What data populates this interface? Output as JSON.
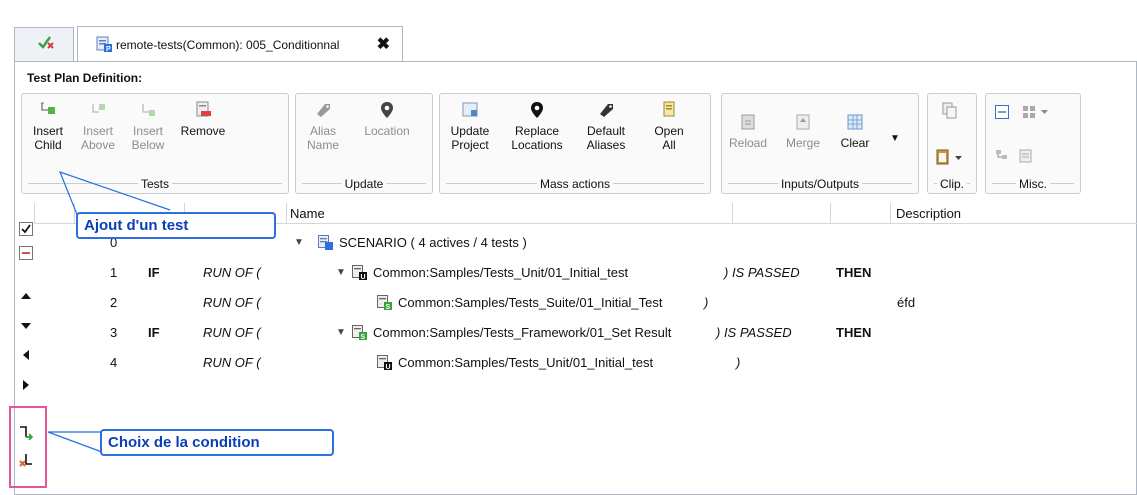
{
  "tabs": [
    {
      "label": ""
    },
    {
      "label": "remote-tests(Common): 005_Conditionnal",
      "close": "✖"
    }
  ],
  "panel": {
    "title": "Test Plan Definition:"
  },
  "ribbon": {
    "groups": [
      {
        "label": "Tests",
        "buttons": [
          {
            "line1": "Insert",
            "line2": "Child",
            "icon": "insert-child-icon",
            "enabled": true
          },
          {
            "line1": "Insert",
            "line2": "Above",
            "icon": "insert-above-icon",
            "enabled": false
          },
          {
            "line1": "Insert",
            "line2": "Below",
            "icon": "insert-below-icon",
            "enabled": false
          },
          {
            "line1": "Remove",
            "line2": "",
            "icon": "remove-icon",
            "enabled": true
          }
        ]
      },
      {
        "label": "Update",
        "buttons": [
          {
            "line1": "Alias",
            "line2": "Name",
            "icon": "tag-icon",
            "enabled": false
          },
          {
            "line1": "Location",
            "line2": "",
            "icon": "location-pin-icon",
            "enabled": false
          }
        ]
      },
      {
        "label": "Mass actions",
        "buttons": [
          {
            "line1": "Update",
            "line2": "Project",
            "icon": "update-project-icon",
            "enabled": true
          },
          {
            "line1": "Replace",
            "line2": "Locations",
            "icon": "location-pin-icon",
            "enabled": true
          },
          {
            "line1": "Default",
            "line2": "Aliases",
            "icon": "tag-icon",
            "enabled": true
          },
          {
            "line1": "Open",
            "line2": "All",
            "icon": "open-all-icon",
            "enabled": true
          }
        ]
      },
      {
        "label": "Inputs/Outputs",
        "buttons": [
          {
            "line1": "Reload",
            "line2": "",
            "icon": "reload-icon",
            "enabled": false
          },
          {
            "line1": "Merge",
            "line2": "",
            "icon": "merge-icon",
            "enabled": false
          },
          {
            "line1": "Clear",
            "line2": "",
            "icon": "clear-icon",
            "enabled": true
          }
        ]
      },
      {
        "label": "Clip."
      },
      {
        "label": "Misc."
      }
    ]
  },
  "table": {
    "columns": {
      "name": "Name",
      "description": "Description"
    },
    "rows": [
      {
        "num": "0",
        "cond": "",
        "run": "",
        "twisty": "▼",
        "label": "SCENARIO ( 4 actives / 4 tests )",
        "tail": "",
        "then": "",
        "desc": "",
        "icon": "scenario-icon"
      },
      {
        "num": "1",
        "cond": "IF",
        "run": "RUN OF (",
        "twisty": "▼",
        "label": "Common:Samples/Tests_Unit/01_Initial_test",
        "tail": ") IS PASSED",
        "then": "THEN",
        "desc": "",
        "icon": "unit-test-icon"
      },
      {
        "num": "2",
        "cond": "",
        "run": "RUN OF (",
        "twisty": "",
        "label": "Common:Samples/Tests_Suite/01_Initial_Test",
        "tail": ")",
        "then": "",
        "desc": "éfd",
        "icon": "suite-test-icon"
      },
      {
        "num": "3",
        "cond": "IF",
        "run": "RUN OF (",
        "twisty": "▼",
        "label": "Common:Samples/Tests_Framework/01_Set Result",
        "tail": ") IS PASSED",
        "then": "THEN",
        "desc": "",
        "icon": "framework-test-icon"
      },
      {
        "num": "4",
        "cond": "",
        "run": "RUN OF (",
        "twisty": "",
        "label": "Common:Samples/Tests_Unit/01_Initial_test",
        "tail": ")",
        "then": "",
        "desc": "",
        "icon": "unit-test-icon"
      }
    ]
  },
  "callouts": {
    "add_test": "Ajout d'un test",
    "condition": "Choix de la condition"
  },
  "colors": {
    "accent_blue": "#2b6fe0",
    "callout_text": "#0b3fb8",
    "highlight_pink": "#e2569b"
  }
}
